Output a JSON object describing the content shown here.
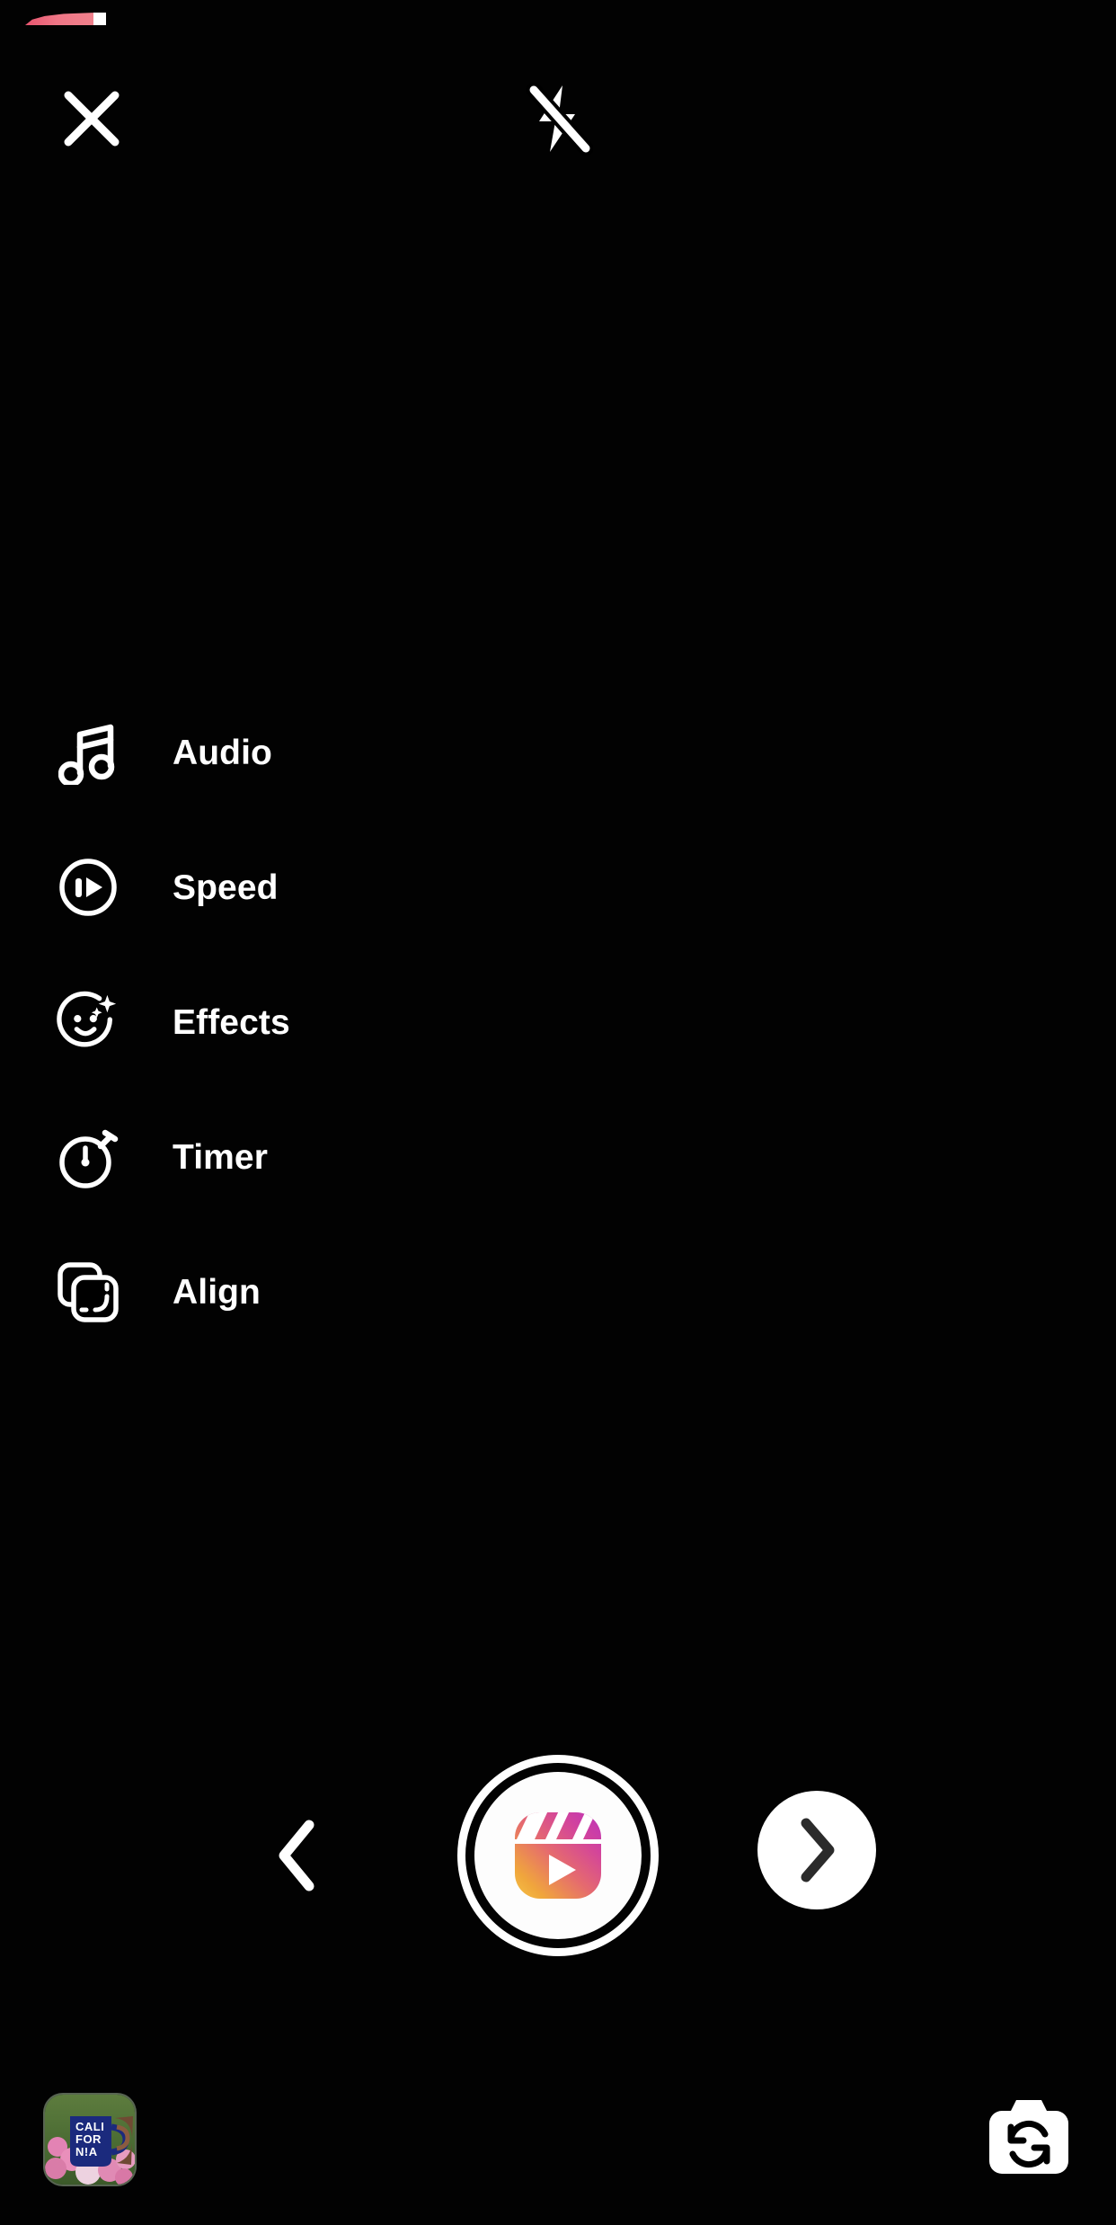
{
  "app": {
    "name": "Instagram Reels Camera",
    "screen": "reels-capture"
  },
  "recording": {
    "progress_percent": 8,
    "track_color": "#000000",
    "fill_gradient_from": "#e8556f",
    "fill_gradient_to": "#f0818c",
    "head_color": "#ffffff"
  },
  "header": {
    "close": {
      "label": "Close",
      "icon": "close-icon"
    },
    "flash": {
      "label": "Flash off",
      "state": "off",
      "icon": "flash-off-icon"
    }
  },
  "tools": {
    "items": [
      {
        "id": "audio",
        "label": "Audio",
        "icon": "music-note-icon"
      },
      {
        "id": "speed",
        "label": "Speed",
        "icon": "speed-icon"
      },
      {
        "id": "effects",
        "label": "Effects",
        "icon": "effects-sparkle-face-icon"
      },
      {
        "id": "timer",
        "label": "Timer",
        "icon": "stopwatch-icon"
      },
      {
        "id": "align",
        "label": "Align",
        "icon": "align-layers-icon"
      }
    ]
  },
  "capture": {
    "shutter": {
      "label": "Record reel",
      "icon": "reels-clapperboard-icon",
      "ring_color": "#ffffff",
      "inner_color": "#fdfdfd",
      "gradient_start": "#f5c242",
      "gradient_mid": "#e8567a",
      "gradient_end": "#b32cc4"
    },
    "prev": {
      "label": "Previous",
      "icon": "chevron-left-icon"
    },
    "next": {
      "label": "Next",
      "icon": "chevron-right-icon",
      "background": "#ffffff",
      "glyph_color": "#262626"
    }
  },
  "footer": {
    "gallery": {
      "label": "Gallery",
      "icon": "photo-thumbnail",
      "thumbnail_alt": "Blue CALIFORNIA mug held in front of pink flowers",
      "mug_text_lines": [
        "CALI",
        "FOR",
        "N!A"
      ],
      "mug_color": "#1c2a80",
      "flower_color": "#e87fb0",
      "foliage_color": "#4e7036"
    },
    "flip_camera": {
      "label": "Switch camera",
      "icon": "camera-flip-icon",
      "body_color": "#ffffff",
      "glyph_color": "#000000"
    }
  }
}
